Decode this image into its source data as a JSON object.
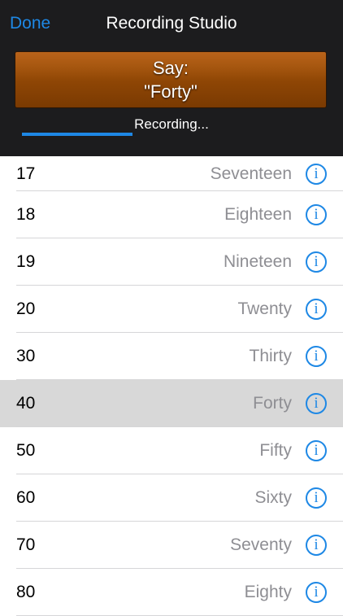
{
  "nav": {
    "done_label": "Done",
    "title": "Recording Studio"
  },
  "prompt": {
    "say_label": "Say:",
    "word": "\"Forty\""
  },
  "recording": {
    "status": "Recording...",
    "progress": 0.37
  },
  "info_glyph": "i",
  "colors": {
    "accent": "#1e88e5",
    "prompt_box": "#8f4605",
    "selected_row": "#d8d8d8"
  },
  "rows": [
    {
      "num": "17",
      "word": "Seventeen"
    },
    {
      "num": "18",
      "word": "Eighteen"
    },
    {
      "num": "19",
      "word": "Nineteen"
    },
    {
      "num": "20",
      "word": "Twenty"
    },
    {
      "num": "30",
      "word": "Thirty"
    },
    {
      "num": "40",
      "word": "Forty",
      "selected": true
    },
    {
      "num": "50",
      "word": "Fifty"
    },
    {
      "num": "60",
      "word": "Sixty"
    },
    {
      "num": "70",
      "word": "Seventy"
    },
    {
      "num": "80",
      "word": "Eighty"
    }
  ]
}
